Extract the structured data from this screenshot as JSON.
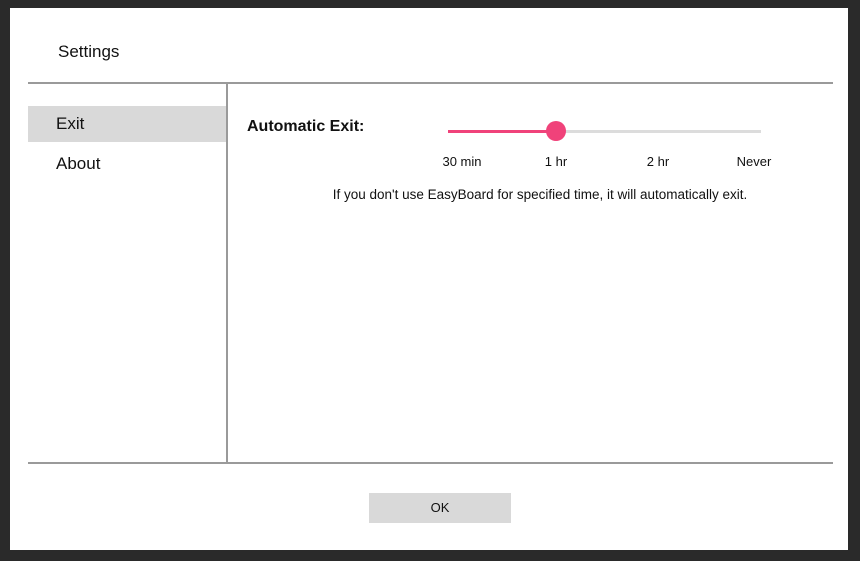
{
  "window": {
    "title": "Settings"
  },
  "sidebar": {
    "items": [
      {
        "label": "Exit",
        "selected": true
      },
      {
        "label": "About",
        "selected": false
      }
    ]
  },
  "exit_settings": {
    "label": "Automatic Exit:",
    "slider": {
      "options": [
        "30 min",
        "1 hr",
        "2 hr",
        "Never"
      ],
      "selected_index": 1,
      "selected_value": "1 hr",
      "accent_color": "#f0427a"
    },
    "description": "If you don't use EasyBoard for specified time, it will automatically exit."
  },
  "footer": {
    "ok_label": "OK"
  }
}
